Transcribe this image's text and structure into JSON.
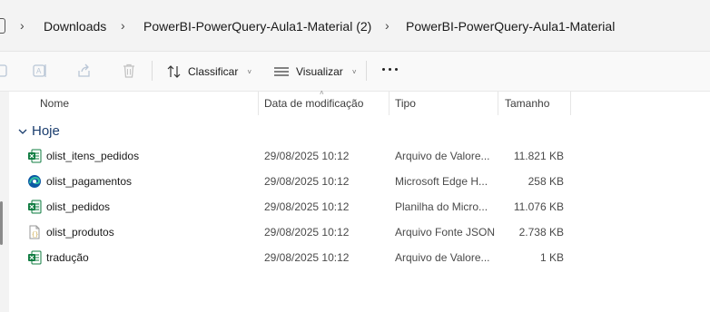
{
  "breadcrumb": {
    "items": [
      {
        "label": "Downloads"
      },
      {
        "label": "PowerBI-PowerQuery-Aula1-Material (2)"
      },
      {
        "label": "PowerBI-PowerQuery-Aula1-Material"
      }
    ]
  },
  "toolbar": {
    "sort_label": "Classificar",
    "view_label": "Visualizar",
    "icons": [
      "new-icon",
      "rename-icon",
      "share-icon",
      "delete-icon",
      "sort-icon",
      "view-icon",
      "more-icon"
    ]
  },
  "columns": {
    "name": "Nome",
    "modified": "Data de modificação",
    "type": "Tipo",
    "size": "Tamanho"
  },
  "group": {
    "label": "Hoje"
  },
  "files": [
    {
      "name": "olist_itens_pedidos",
      "modified": "29/08/2025 10:12",
      "type": "Arquivo de Valore...",
      "size": "11.821 KB",
      "icon": "excel-csv-icon"
    },
    {
      "name": "olist_pagamentos",
      "modified": "29/08/2025 10:12",
      "type": "Microsoft Edge H...",
      "size": "258 KB",
      "icon": "edge-html-icon"
    },
    {
      "name": "olist_pedidos",
      "modified": "29/08/2025 10:12",
      "type": "Planilha do Micro...",
      "size": "11.076 KB",
      "icon": "excel-xlsx-icon"
    },
    {
      "name": "olist_produtos",
      "modified": "29/08/2025 10:12",
      "type": "Arquivo Fonte JSON",
      "size": "2.738 KB",
      "icon": "json-file-icon"
    },
    {
      "name": "tradução",
      "modified": "29/08/2025 10:12",
      "type": "Arquivo de Valore...",
      "size": "1 KB",
      "icon": "excel-csv-icon"
    }
  ],
  "colors": {
    "accent": "#1a3d6e",
    "excel": "#107c41",
    "edge": "#0c59a4"
  }
}
